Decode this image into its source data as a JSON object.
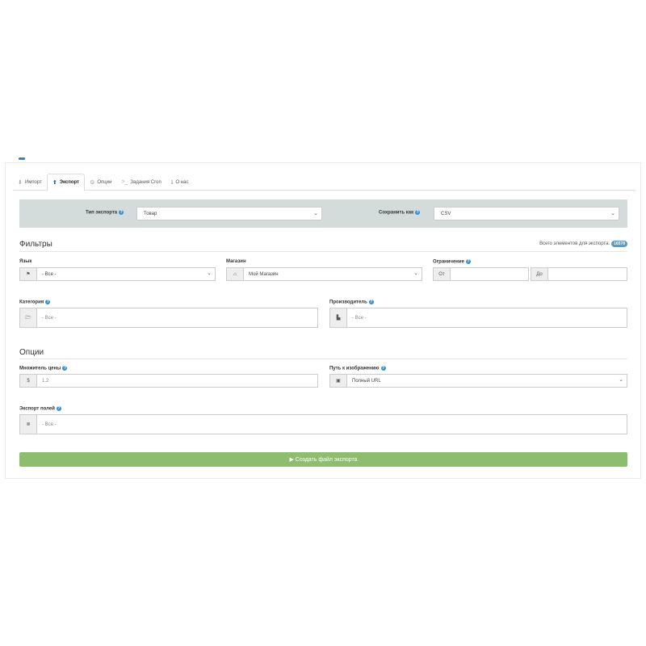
{
  "tabs": [
    {
      "label": "Импорт",
      "icon": "download-icon",
      "glyph": "⬇"
    },
    {
      "label": "Экспорт",
      "icon": "upload-icon",
      "glyph": "⬆"
    },
    {
      "label": "Опции",
      "icon": "gear-icon",
      "glyph": "⚙"
    },
    {
      "label": "Задания Cron",
      "icon": "terminal-icon",
      "glyph": ">_"
    },
    {
      "label": "О нас",
      "icon": "info-icon",
      "glyph": "ℹ"
    }
  ],
  "export_type": {
    "label": "Тип экспорта",
    "value": "Товар"
  },
  "save_as": {
    "label": "Сохранить как",
    "value": "CSV"
  },
  "filters": {
    "title": "Фильтры",
    "total_label": "Всего элементов для экспорта:",
    "total_count": "16578",
    "language": {
      "label": "Язык",
      "value": "- Все -"
    },
    "store": {
      "label": "Магазин",
      "value": "Мой Магазин"
    },
    "limit": {
      "label": "Ограничение",
      "from_label": "От",
      "to_label": "До",
      "from_value": "",
      "to_value": ""
    },
    "category": {
      "label": "Категория",
      "value": "- Все -"
    },
    "manufacturer": {
      "label": "Производитель",
      "value": "- Все -"
    }
  },
  "options": {
    "title": "Опции",
    "price_multiplier": {
      "label": "Множитель цены",
      "addon": "$",
      "placeholder": "1.2"
    },
    "image_path": {
      "label": "Путь к изображению",
      "value": "Полный URL"
    },
    "export_fields": {
      "label": "Экспорт полей",
      "value": "- Все -"
    }
  },
  "create_button": {
    "label": "▶ Создать файл экспорта"
  },
  "colors": {
    "accent": "#3a8fd0",
    "button": "#8fbd6f",
    "bar": "#d4dcdb"
  }
}
